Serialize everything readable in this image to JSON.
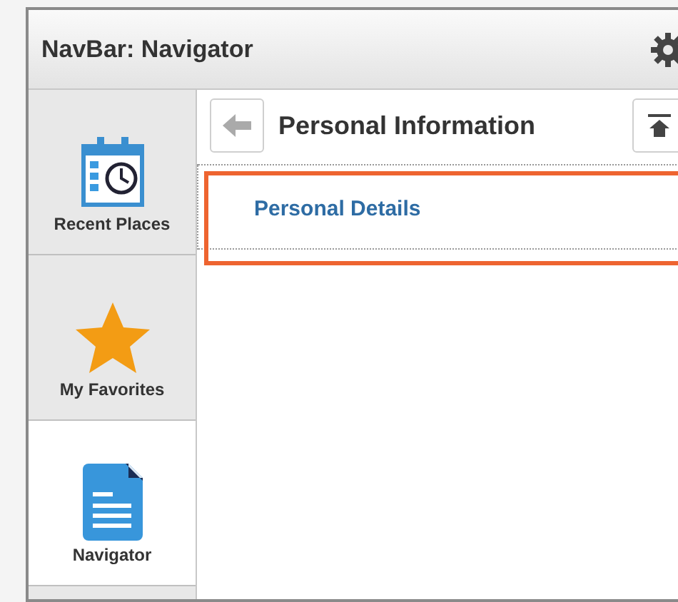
{
  "window": {
    "title": "NavBar: Navigator"
  },
  "sidebar": {
    "items": [
      {
        "label": "Recent Places",
        "kind": "calendar",
        "selected": false
      },
      {
        "label": "My Favorites",
        "kind": "star",
        "selected": false
      },
      {
        "label": "Navigator",
        "kind": "document",
        "selected": true
      }
    ]
  },
  "content": {
    "title": "Personal Information",
    "items": [
      {
        "label": "Personal Details",
        "selected": true
      }
    ]
  }
}
